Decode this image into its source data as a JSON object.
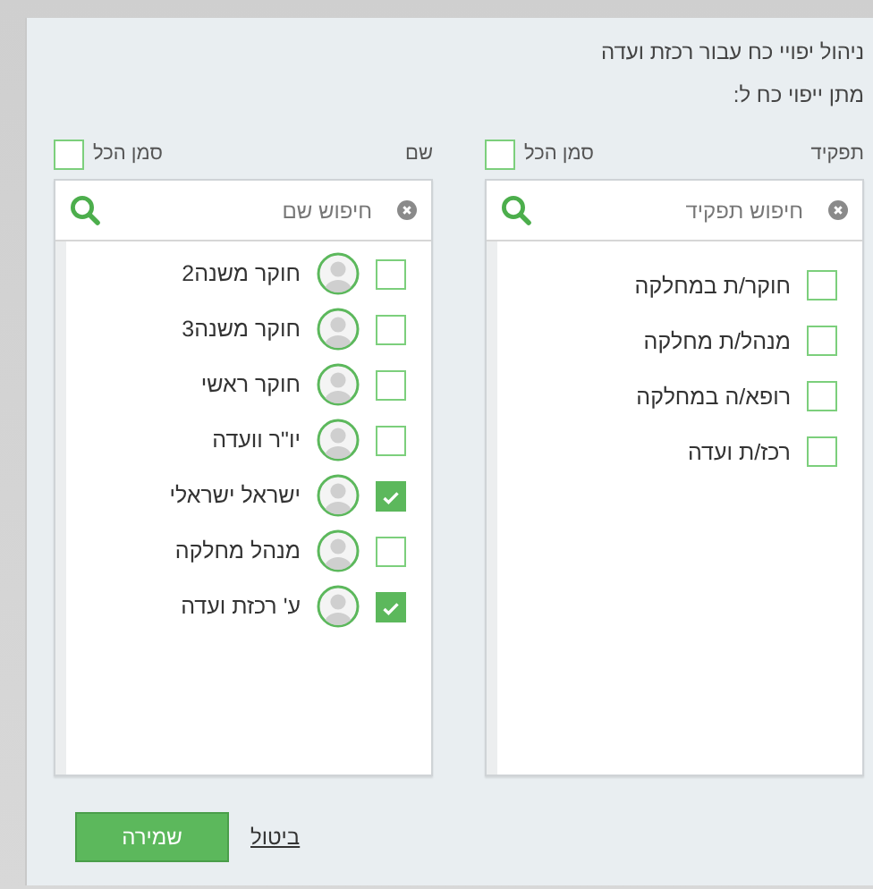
{
  "title": "ניהול יפויי כח עבור רכזת ועדה",
  "subtitle": "מתן ייפוי כח ל:",
  "panels": [
    {
      "heading": "תפקיד",
      "select_all": {
        "label": "סמן הכל",
        "checked": false
      },
      "search": {
        "placeholder": "חיפוש תפקיד"
      },
      "items": [
        {
          "kind": "role",
          "label": "חוקר/ת במחלקה",
          "checked": false
        },
        {
          "kind": "role",
          "label": "מנהל/ת מחלקה",
          "checked": false
        },
        {
          "kind": "role",
          "label": "רופא/ה במחלקה",
          "checked": false
        },
        {
          "kind": "role",
          "label": "רכז/ת ועדה",
          "checked": false
        }
      ]
    },
    {
      "heading": "שם",
      "select_all": {
        "label": "סמן הכל",
        "checked": false
      },
      "search": {
        "placeholder": "חיפוש שם"
      },
      "items": [
        {
          "kind": "person",
          "label": "חוקר משנה2",
          "checked": false
        },
        {
          "kind": "person",
          "label": "חוקר משנה3",
          "checked": false
        },
        {
          "kind": "person",
          "label": "חוקר ראשי",
          "checked": false
        },
        {
          "kind": "person",
          "label": "יו\"ר וועדה",
          "checked": false
        },
        {
          "kind": "person",
          "label": "ישראל ישראלי",
          "checked": true
        },
        {
          "kind": "person",
          "label": "מנהל מחלקה",
          "checked": false
        },
        {
          "kind": "person",
          "label": "ע' רכזת ועדה",
          "checked": true
        }
      ]
    }
  ],
  "buttons": [
    {
      "kind": "cancel",
      "label": "ביטול"
    },
    {
      "kind": "save",
      "label": "שמירה"
    }
  ]
}
